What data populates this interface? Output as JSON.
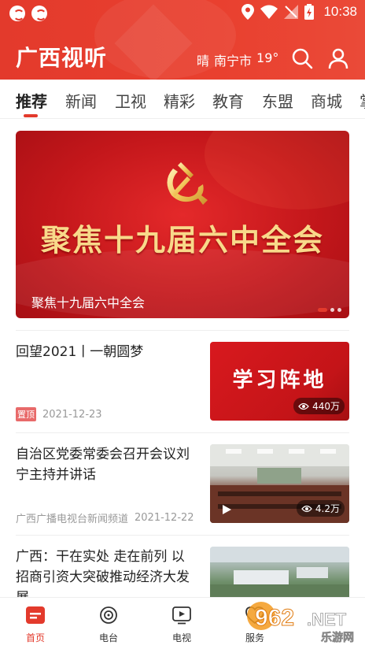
{
  "status_bar": {
    "time": "10:38",
    "icons": [
      "app-circle-icon",
      "app-circle-icon",
      "location-icon",
      "wifi-icon",
      "signal-icon",
      "battery-icon"
    ]
  },
  "header": {
    "app_title": "广西视听",
    "weather": {
      "condition": "晴",
      "city": "南宁市",
      "temperature": "19°"
    },
    "icons": [
      "search-icon",
      "user-icon"
    ]
  },
  "tabs": {
    "items": [
      {
        "label": "推荐",
        "active": true
      },
      {
        "label": "新闻"
      },
      {
        "label": "卫视"
      },
      {
        "label": "精彩"
      },
      {
        "label": "教育"
      },
      {
        "label": "东盟"
      },
      {
        "label": "商城"
      },
      {
        "label": "掌"
      }
    ]
  },
  "banner": {
    "headline": "聚焦十九届六中全会",
    "caption": "聚焦十九届六中全会",
    "slide_count": 3,
    "active_slide": 1
  },
  "articles": [
    {
      "title": "回望2021丨一朝圆梦",
      "badge": "置顶",
      "date": "2021-12-23",
      "thumb_text": "学习阵地",
      "views": "440万"
    },
    {
      "title": "自治区党委常委会召开会议刘宁主持并讲话",
      "source": "广西广播电视台新闻频道",
      "date": "2021-12-22",
      "views": "4.2万",
      "has_play": true
    },
    {
      "title": "广西：干在实处 走在前列 以招商引资大突破推动经济大发展"
    }
  ],
  "bottom_nav": {
    "items": [
      {
        "label": "首页",
        "icon": "home-icon",
        "active": true
      },
      {
        "label": "电台",
        "icon": "radio-icon"
      },
      {
        "label": "电视",
        "icon": "tv-icon"
      },
      {
        "label": "服务",
        "icon": "service-icon"
      }
    ]
  },
  "watermark": {
    "main": "962",
    "domain": ".NET",
    "sub": "乐游网"
  },
  "colors": {
    "brand_red": "#e33a2c",
    "gold_text": "#f8d98a"
  }
}
